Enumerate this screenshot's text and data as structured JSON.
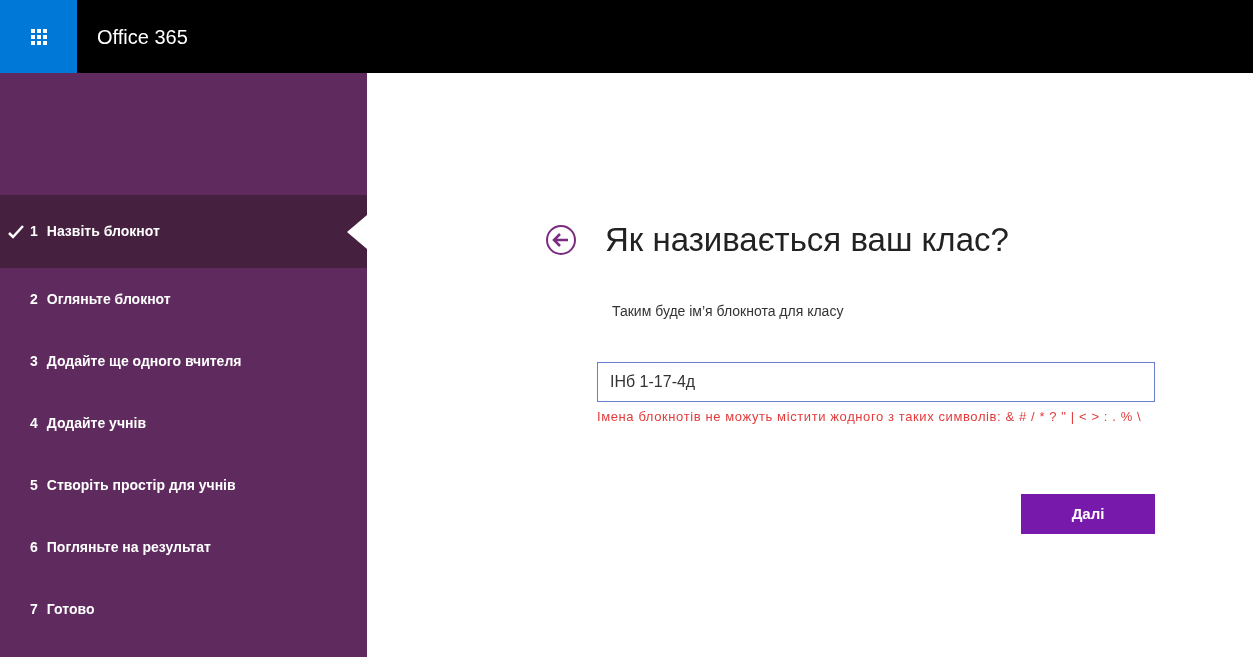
{
  "header": {
    "title": "Office 365"
  },
  "steps": [
    {
      "number": "1",
      "label": "Назвіть блокнот",
      "selected": true,
      "done": true
    },
    {
      "number": "2",
      "label": "Огляньте блокнот",
      "selected": false,
      "done": false
    },
    {
      "number": "3",
      "label": "Додайте ще одного вчителя",
      "selected": false,
      "done": false
    },
    {
      "number": "4",
      "label": "Додайте учнів",
      "selected": false,
      "done": false
    },
    {
      "number": "5",
      "label": "Створіть простір для учнів",
      "selected": false,
      "done": false
    },
    {
      "number": "6",
      "label": "Погляньте на результат",
      "selected": false,
      "done": false
    },
    {
      "number": "7",
      "label": "Готово",
      "selected": false,
      "done": false
    }
  ],
  "page": {
    "title": "Як називається ваш клас?",
    "subtitle": "Таким буде ім’я блокнота для класу",
    "name_field": {
      "value": "ІНб 1-17-4д"
    },
    "error": "Імена блокнотів не можуть містити жодного з таких символів: & # / * ? \" | < > : . % \\",
    "next_button": "Далі"
  }
}
